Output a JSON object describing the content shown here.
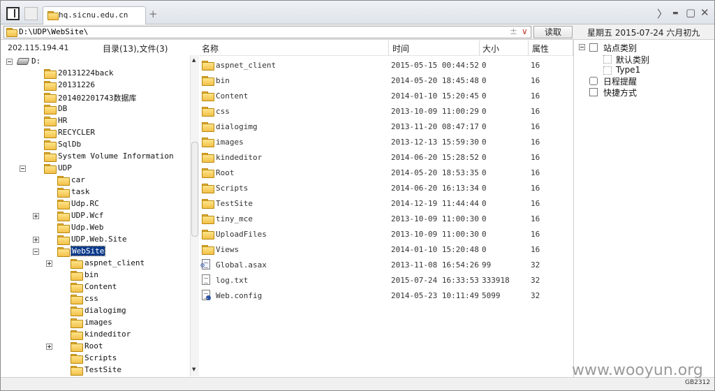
{
  "titlebar": {
    "tab_title": "hq.sicnu.edu.cn",
    "add_tab": "+",
    "controls": {
      "forward": "〉",
      "minimize": "▬",
      "maximize": "▢",
      "close": "✕"
    }
  },
  "address": {
    "path": "D:\\UDP\\WebSite\\",
    "plus": "±",
    "dropdown": "∨",
    "read_button": "读取",
    "date": "星期五 2015-07-24 六月初九"
  },
  "info": {
    "ip": "202.115.194.41",
    "dir_summary": "目录(13),文件(3)"
  },
  "columns": {
    "name": "名称",
    "time": "时间",
    "size": "大小",
    "attr": "属性"
  },
  "tree": [
    {
      "label": "D:",
      "level": 0,
      "expander": "minus",
      "icon": "drive"
    },
    {
      "label": "20131224back",
      "level": 1,
      "expander": "",
      "icon": "folder"
    },
    {
      "label": "20131226",
      "level": 1,
      "expander": "",
      "icon": "folder"
    },
    {
      "label": "201402201743数据库",
      "level": 1,
      "expander": "",
      "icon": "folder"
    },
    {
      "label": "DB",
      "level": 1,
      "expander": "",
      "icon": "folder"
    },
    {
      "label": "HR",
      "level": 1,
      "expander": "",
      "icon": "folder"
    },
    {
      "label": "RECYCLER",
      "level": 1,
      "expander": "",
      "icon": "folder"
    },
    {
      "label": "SqlDb",
      "level": 1,
      "expander": "",
      "icon": "folder"
    },
    {
      "label": "System Volume Information",
      "level": 1,
      "expander": "",
      "icon": "folder"
    },
    {
      "label": "UDP",
      "level": 1,
      "expander": "minus",
      "icon": "folder"
    },
    {
      "label": "car",
      "level": 2,
      "expander": "",
      "icon": "folder"
    },
    {
      "label": "task",
      "level": 2,
      "expander": "",
      "icon": "folder"
    },
    {
      "label": "Udp.RC",
      "level": 2,
      "expander": "",
      "icon": "folder"
    },
    {
      "label": "UDP.Wcf",
      "level": 2,
      "expander": "plus",
      "icon": "folder"
    },
    {
      "label": "Udp.Web",
      "level": 2,
      "expander": "",
      "icon": "folder"
    },
    {
      "label": "UDP.Web.Site",
      "level": 2,
      "expander": "plus",
      "icon": "folder"
    },
    {
      "label": "WebSite",
      "level": 2,
      "expander": "minus",
      "icon": "folder",
      "selected": true
    },
    {
      "label": "aspnet_client",
      "level": 3,
      "expander": "plus",
      "icon": "folder"
    },
    {
      "label": "bin",
      "level": 3,
      "expander": "",
      "icon": "folder"
    },
    {
      "label": "Content",
      "level": 3,
      "expander": "",
      "icon": "folder"
    },
    {
      "label": "css",
      "level": 3,
      "expander": "",
      "icon": "folder"
    },
    {
      "label": "dialogimg",
      "level": 3,
      "expander": "",
      "icon": "folder"
    },
    {
      "label": "images",
      "level": 3,
      "expander": "",
      "icon": "folder"
    },
    {
      "label": "kindeditor",
      "level": 3,
      "expander": "",
      "icon": "folder"
    },
    {
      "label": "Root",
      "level": 3,
      "expander": "plus",
      "icon": "folder"
    },
    {
      "label": "Scripts",
      "level": 3,
      "expander": "",
      "icon": "folder"
    },
    {
      "label": "TestSite",
      "level": 3,
      "expander": "",
      "icon": "folder"
    }
  ],
  "files": [
    {
      "name": "aspnet_client",
      "time": "2015-05-15 00:44:52",
      "size": "0",
      "attr": "16",
      "icon": "folder"
    },
    {
      "name": "bin",
      "time": "2014-05-20 18:45:48",
      "size": "0",
      "attr": "16",
      "icon": "folder"
    },
    {
      "name": "Content",
      "time": "2014-01-10 15:20:45",
      "size": "0",
      "attr": "16",
      "icon": "folder"
    },
    {
      "name": "css",
      "time": "2013-10-09 11:00:29",
      "size": "0",
      "attr": "16",
      "icon": "folder"
    },
    {
      "name": "dialogimg",
      "time": "2013-11-20 08:47:17",
      "size": "0",
      "attr": "16",
      "icon": "folder"
    },
    {
      "name": "images",
      "time": "2013-12-13 15:59:30",
      "size": "0",
      "attr": "16",
      "icon": "folder"
    },
    {
      "name": "kindeditor",
      "time": "2014-06-20 15:28:52",
      "size": "0",
      "attr": "16",
      "icon": "folder"
    },
    {
      "name": "Root",
      "time": "2014-05-20 18:53:35",
      "size": "0",
      "attr": "16",
      "icon": "folder"
    },
    {
      "name": "Scripts",
      "time": "2014-06-20 16:13:34",
      "size": "0",
      "attr": "16",
      "icon": "folder"
    },
    {
      "name": "TestSite",
      "time": "2014-12-19 11:44:44",
      "size": "0",
      "attr": "16",
      "icon": "folder"
    },
    {
      "name": "tiny_mce",
      "time": "2013-10-09 11:00:30",
      "size": "0",
      "attr": "16",
      "icon": "folder"
    },
    {
      "name": "UploadFiles",
      "time": "2013-10-09 11:00:30",
      "size": "0",
      "attr": "16",
      "icon": "folder"
    },
    {
      "name": "Views",
      "time": "2014-01-10 15:20:48",
      "size": "0",
      "attr": "16",
      "icon": "folder"
    },
    {
      "name": "Global.asax",
      "time": "2013-11-08 16:54:26",
      "size": "99",
      "attr": "32",
      "icon": "gear-file"
    },
    {
      "name": "log.txt",
      "time": "2015-07-24 16:33:53",
      "size": "333918",
      "attr": "32",
      "icon": "text-file"
    },
    {
      "name": "Web.config",
      "time": "2014-05-23 10:11:49",
      "size": "5099",
      "attr": "32",
      "icon": "config-file"
    }
  ],
  "right_panel": [
    {
      "label": "站点类别",
      "level": 0,
      "expander": "minus",
      "icon": "box"
    },
    {
      "label": "默认类别",
      "level": 1,
      "expander": "",
      "icon": "dotted-box"
    },
    {
      "label": "Type1",
      "level": 1,
      "expander": "",
      "icon": "dotted-box"
    },
    {
      "label": "日程提醒",
      "level": 0,
      "expander": "",
      "icon": "clock"
    },
    {
      "label": "快捷方式",
      "level": 0,
      "expander": "",
      "icon": "shortcut"
    }
  ],
  "status": {
    "watermark": "www.wooyun.org",
    "encoding": "GB2312"
  },
  "colors": {
    "selection": "#0a3a8c",
    "folder": "#f2c14a",
    "accent_red": "#c0392b"
  }
}
